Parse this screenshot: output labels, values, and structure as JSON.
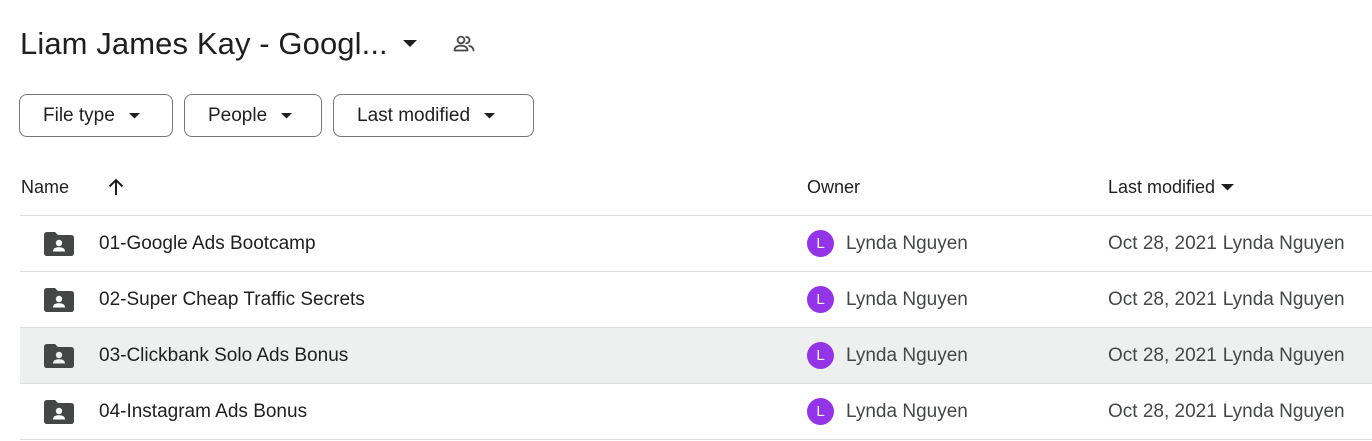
{
  "header": {
    "title": "Liam James Kay - Googl..."
  },
  "filters": {
    "file_type": "File type",
    "people": "People",
    "last_modified": "Last modified"
  },
  "columns": {
    "name": "Name",
    "owner": "Owner",
    "last_modified": "Last modified"
  },
  "rows": [
    {
      "name": "01-Google Ads Bootcamp",
      "avatar": "L",
      "owner": "Lynda Nguyen",
      "date": "Oct 28, 2021",
      "modified_by": "Lynda Nguyen"
    },
    {
      "name": "02-Super Cheap Traffic Secrets",
      "avatar": "L",
      "owner": "Lynda Nguyen",
      "date": "Oct 28, 2021",
      "modified_by": "Lynda Nguyen"
    },
    {
      "name": "03-Clickbank Solo Ads Bonus",
      "avatar": "L",
      "owner": "Lynda Nguyen",
      "date": "Oct 28, 2021",
      "modified_by": "Lynda Nguyen"
    },
    {
      "name": "04-Instagram Ads Bonus",
      "avatar": "L",
      "owner": "Lynda Nguyen",
      "date": "Oct 28, 2021",
      "modified_by": "Lynda Nguyen"
    }
  ],
  "icons": {
    "title_caret": "arrow-drop-down-icon",
    "share": "people-icon",
    "sort": "arrow-up-icon",
    "folder": "shared-folder-icon"
  },
  "colors": {
    "avatar": "#9334e6",
    "selected_row": "#eef0ef",
    "icon": "#444746"
  }
}
